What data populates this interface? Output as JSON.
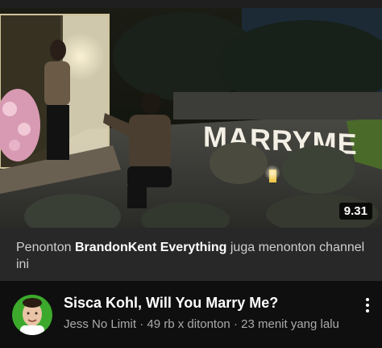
{
  "video": {
    "duration": "9.31",
    "sign_text": "MARRYME",
    "title": "Sisca Kohl, Will You Marry Me?",
    "channel": "Jess No Limit",
    "separator": " · ",
    "views": "49 rb x ditonton",
    "uploaded": "23 menit yang lalu"
  },
  "banner": {
    "prefix": "Penonton ",
    "highlight": "BrandonKent Everything",
    "suffix": " juga menonton channel ini"
  },
  "icons": {
    "menu": "more-vert-icon",
    "avatar": "channel-avatar"
  },
  "colors": {
    "background": "#0f0f0f",
    "banner_bg": "#282828",
    "avatar_bg": "#3ca92c",
    "meta_text": "#aaaaaa"
  }
}
